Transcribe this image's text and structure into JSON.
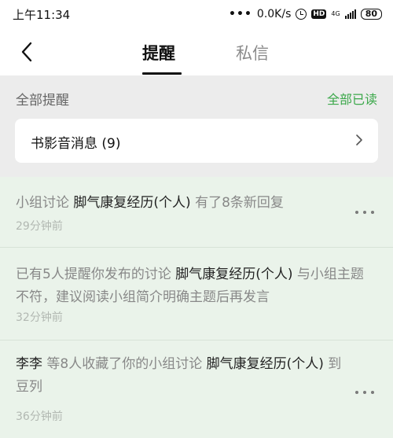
{
  "status_bar": {
    "time": "上午11:34",
    "network_speed": "0.0K/s",
    "hd": "HD",
    "net_type": "4G",
    "battery": "80"
  },
  "nav": {
    "tabs": [
      {
        "label": "提醒",
        "active": true
      },
      {
        "label": "私信",
        "active": false
      }
    ]
  },
  "section": {
    "title": "全部提醒",
    "mark_all_read": "全部已读"
  },
  "media_card": {
    "label": "书影音消息 (9)"
  },
  "notifications": [
    {
      "parts": [
        "小组讨论 ",
        "脚气康复经历(个人)",
        " 有了8条新回复"
      ],
      "time": "29分钟前"
    },
    {
      "parts": [
        "已有5人提醒你发布的讨论 ",
        "脚气康复经历(个人)",
        " 与小组主题不符，建议阅读小组简介明确主题后再发言"
      ],
      "time": "32分钟前"
    },
    {
      "parts": [
        "李李",
        " 等8人收藏了你的小组讨论 ",
        "脚气康复经历(个人)",
        " 到豆列"
      ],
      "time": "36分钟前"
    }
  ],
  "colors": {
    "accent": "#3ba84a",
    "notification_bg": "#eaf3ea",
    "background": "#ececec"
  }
}
